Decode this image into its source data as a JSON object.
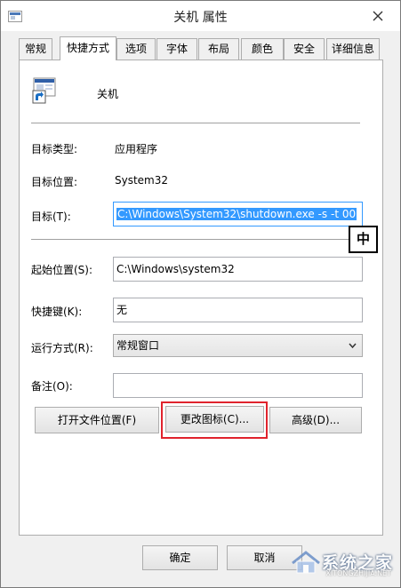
{
  "window": {
    "title": "关机 属性",
    "icon": "window-properties-icon"
  },
  "tabs": [
    {
      "label": "常规",
      "active": false
    },
    {
      "label": "快捷方式",
      "active": true
    },
    {
      "label": "选项",
      "active": false
    },
    {
      "label": "字体",
      "active": false
    },
    {
      "label": "布局",
      "active": false
    },
    {
      "label": "颜色",
      "active": false
    },
    {
      "label": "安全",
      "active": false
    },
    {
      "label": "详细信息",
      "active": false
    }
  ],
  "shortcut": {
    "name": "关机",
    "icon": "shortcut-arrow-icon"
  },
  "info": {
    "target_type_label": "目标类型:",
    "target_type_value": "应用程序",
    "target_location_label": "目标位置:",
    "target_location_value": "System32"
  },
  "target": {
    "label": "目标(T):",
    "value": "C:\\Windows\\System32\\shutdown.exe -s -t 00"
  },
  "ime_indicator": "中",
  "start_in": {
    "label": "起始位置(S):",
    "value": "C:\\Windows\\system32"
  },
  "shortcut_key": {
    "label": "快捷键(K):",
    "value": "无"
  },
  "run": {
    "label": "运行方式(R):",
    "value": "常规窗口"
  },
  "comment": {
    "label": "备注(O):",
    "value": ""
  },
  "buttons": {
    "open_location": "打开文件位置(F)",
    "change_icon": "更改图标(C)...",
    "advanced": "高级(D)..."
  },
  "footer": {
    "ok": "确定",
    "cancel": "取消"
  },
  "watermark": {
    "text": "系统之家",
    "subtext": "XITONGZHIJIA.NET"
  },
  "colors": {
    "selection": "#3399ff",
    "highlight_box": "#e0232d"
  }
}
